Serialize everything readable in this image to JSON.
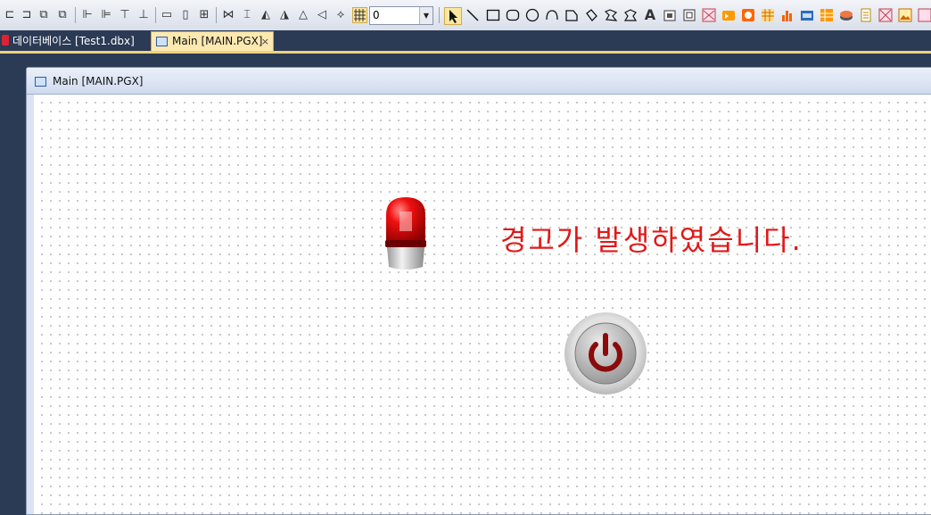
{
  "toolbar": {
    "zoom_value": "0",
    "icons": [
      "align-left-icon",
      "align-center-icon",
      "align-right-icon",
      "align-top-icon",
      "align-middle-icon",
      "align-bottom-icon",
      "same-width-icon",
      "same-height-icon",
      "same-size-icon",
      "space-horizontal-icon",
      "space-vertical-icon",
      "flip-horizontal-icon",
      "flip-vertical-icon",
      "rotate-left-icon",
      "rotate-right-icon",
      "grid-icon",
      "pointer-icon",
      "line-icon",
      "rectangle-icon",
      "rounded-rectangle-icon",
      "ellipse-icon",
      "arc-icon",
      "polygon-icon",
      "pie-icon",
      "polyline-icon",
      "text-icon",
      "bitmap-icon",
      "button-icon",
      "trend-icon",
      "alarm-icon",
      "lamp-icon",
      "chart-icon",
      "bar-graph-icon",
      "meter-icon",
      "table-icon",
      "disk-icon",
      "document-icon",
      "image-icon"
    ]
  },
  "tabs": [
    {
      "label": "데이터베이스 [Test1.dbx]",
      "active": false
    },
    {
      "label": "Main [MAIN.PGX]",
      "active": true,
      "close": "×"
    }
  ],
  "window": {
    "title": "Main [MAIN.PGX]"
  },
  "canvas": {
    "message": "경고가 발생하였습니다.",
    "message_color": "#e21818"
  },
  "colors": {
    "accent": "#f3d27c",
    "frame": "#2b3a55",
    "active_tab": "#fbe9b1"
  }
}
